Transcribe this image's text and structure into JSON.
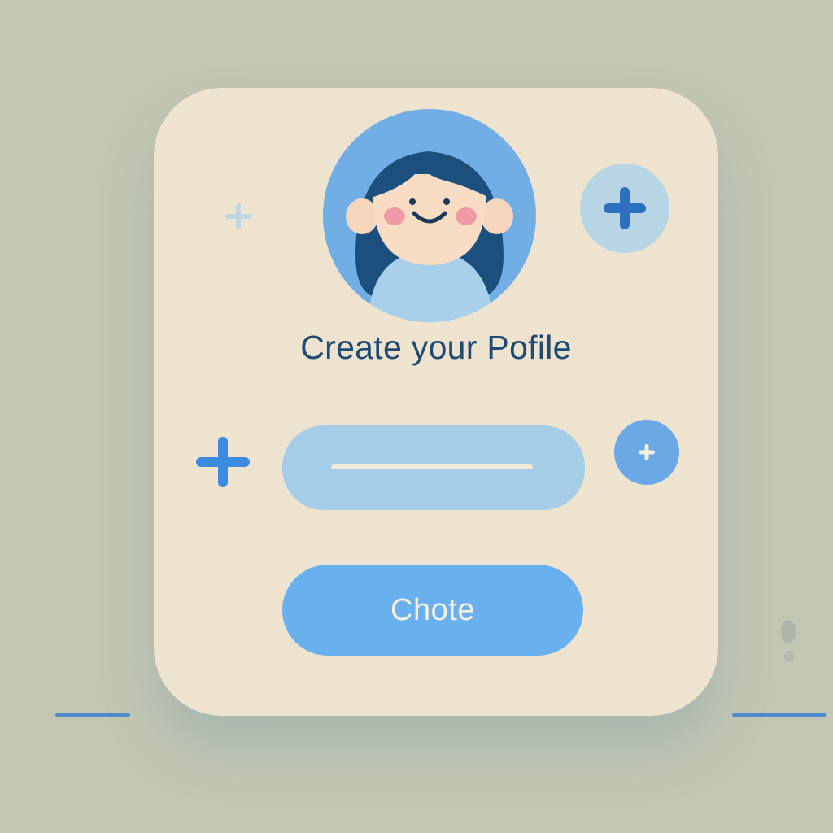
{
  "profile_form": {
    "title": "Create your Pofile",
    "name_field": {
      "value": "",
      "placeholder": ""
    },
    "submit_label": "Chote"
  },
  "icons": {
    "avatar": "girl-avatar-icon",
    "add_top": "plus-icon",
    "add_left": "plus-icon",
    "add_right": "plus-icon",
    "decor": "plus-icon"
  },
  "colors": {
    "background": "#c3c6b3",
    "card": "#eee3cf",
    "accent": "#4d8dcc",
    "button": "#69b0ee",
    "input": "#a5cde8",
    "title_text": "#1e4a73"
  }
}
